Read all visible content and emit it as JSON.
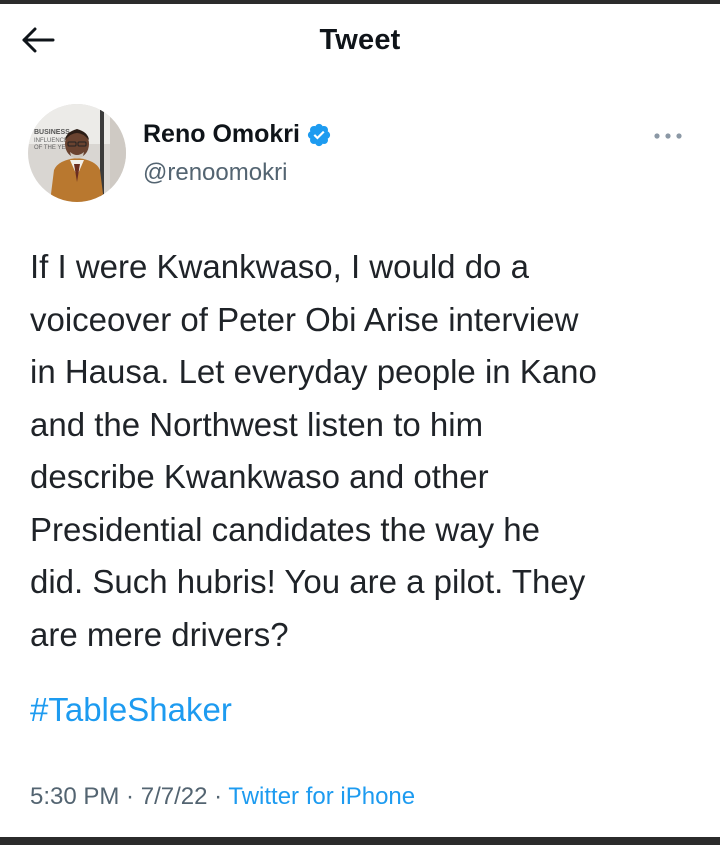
{
  "header": {
    "title": "Tweet",
    "back_icon": "arrow-left-icon"
  },
  "author": {
    "display_name": "Reno Omokri",
    "handle": "@renoomokri",
    "verified_icon": "verified-badge-icon",
    "more_icon": "more-horizontal-icon",
    "avatar_icon": "avatar-image",
    "avatar_text": [
      "BUSINESS",
      "INFLUENCER",
      "OF THE YEAR"
    ]
  },
  "tweet": {
    "text": "If I were Kwankwaso, I would do a\nvoiceover of Peter Obi Arise interview\nin Hausa. Let everyday people in Kano\nand the Northwest listen to him\ndescribe Kwankwaso and other\nPresidential candidates the way he\ndid. Such hubris! You are a pilot. They\nare mere drivers?",
    "hashtag": "#TableShaker"
  },
  "meta": {
    "time": "5:30 PM",
    "separator": " · ",
    "date": "7/7/22",
    "source": "Twitter for iPhone"
  },
  "colors": {
    "accent": "#1d9bf0",
    "secondary_text": "#536471",
    "primary_text": "#0f1419"
  }
}
